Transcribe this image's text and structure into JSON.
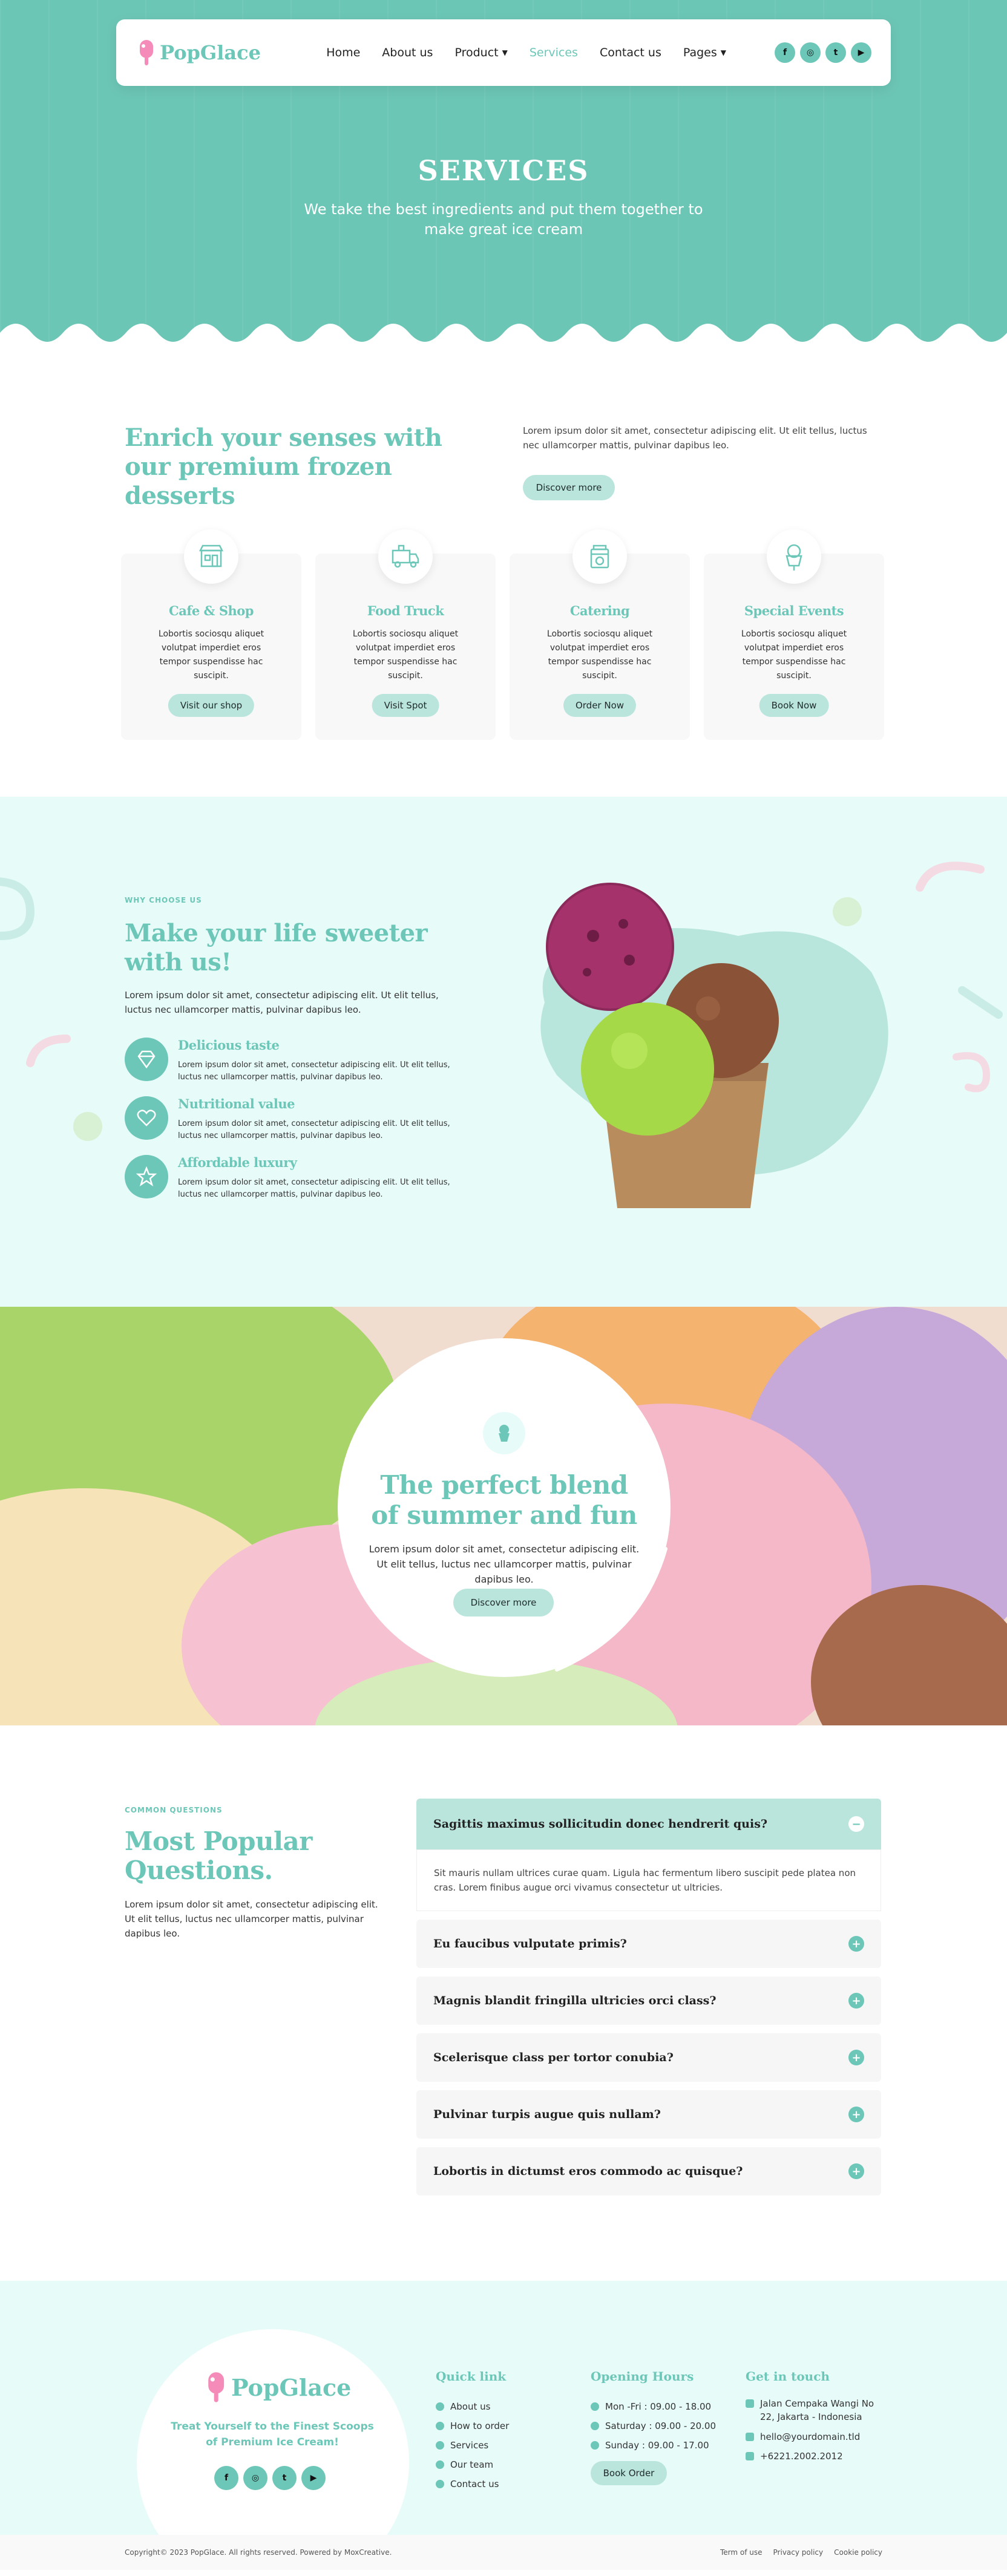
{
  "brand": {
    "name": "PopGlace",
    "primary": "#6cc7b8",
    "light": "#e7fbf8",
    "button": "#b9e5dc"
  },
  "nav": {
    "items": [
      {
        "label": "Home",
        "dropdown": false,
        "active": false
      },
      {
        "label": "About us",
        "dropdown": false,
        "active": false
      },
      {
        "label": "Product",
        "dropdown": true,
        "active": false
      },
      {
        "label": "Services",
        "dropdown": false,
        "active": true
      },
      {
        "label": "Contact us",
        "dropdown": false,
        "active": false
      },
      {
        "label": "Pages",
        "dropdown": true,
        "active": false
      }
    ],
    "social": [
      "facebook-icon",
      "instagram-icon",
      "twitter-icon",
      "youtube-icon"
    ]
  },
  "hero": {
    "title": "SERVICES",
    "subtitle": "We take the best ingredients and put them together to make great ice cream"
  },
  "enrich": {
    "title": "Enrich your senses with our premium frozen desserts",
    "text": "Lorem ipsum dolor sit amet, consectetur adipiscing elit. Ut elit tellus, luctus nec ullamcorper mattis, pulvinar dapibus leo.",
    "button": "Discover more",
    "cards": [
      {
        "icon": "shop-icon",
        "title": "Cafe & Shop",
        "text": "Lobortis sociosqu aliquet volutpat imperdiet eros tempor suspendisse hac suscipit.",
        "button": "Visit our shop"
      },
      {
        "icon": "food-truck-icon",
        "title": "Food Truck",
        "text": "Lobortis sociosqu aliquet volutpat imperdiet eros tempor suspendisse hac suscipit.",
        "button": "Visit Spot"
      },
      {
        "icon": "catering-icon",
        "title": "Catering",
        "text": "Lobortis sociosqu aliquet volutpat imperdiet eros tempor suspendisse hac suscipit.",
        "button": "Order Now"
      },
      {
        "icon": "ice-cream-cup-icon",
        "title": "Special Events",
        "text": "Lobortis sociosqu aliquet volutpat imperdiet eros tempor suspendisse hac suscipit.",
        "button": "Book Now"
      }
    ]
  },
  "why": {
    "eyebrow": "WHY CHOOSE US",
    "title": "Make your life sweeter with us!",
    "text": "Lorem ipsum dolor sit amet, consectetur adipiscing elit. Ut elit tellus, luctus nec ullamcorper mattis, pulvinar dapibus leo.",
    "features": [
      {
        "icon": "diamond-icon",
        "title": "Delicious taste",
        "text": "Lorem ipsum dolor sit amet, consectetur adipiscing elit. Ut elit tellus, luctus nec ullamcorper mattis, pulvinar dapibus leo."
      },
      {
        "icon": "heart-icon",
        "title": "Nutritional value",
        "text": "Lorem ipsum dolor sit amet, consectetur adipiscing elit. Ut elit tellus, luctus nec ullamcorper mattis, pulvinar dapibus leo."
      },
      {
        "icon": "star-icon",
        "title": "Affordable luxury",
        "text": "Lorem ipsum dolor sit amet, consectetur adipiscing elit. Ut elit tellus, luctus nec ullamcorper mattis, pulvinar dapibus leo."
      }
    ]
  },
  "blend": {
    "title": "The perfect blend of summer and fun",
    "text": "Lorem ipsum dolor sit amet, consectetur adipiscing elit. Ut elit tellus, luctus nec ullamcorper mattis, pulvinar dapibus leo.",
    "button": "Discover more"
  },
  "faq": {
    "eyebrow": "COMMON QUESTIONS",
    "title": "Most Popular Questions.",
    "text": "Lorem ipsum dolor sit amet, consectetur adipiscing elit. Ut elit tellus, luctus nec ullamcorper mattis, pulvinar dapibus leo.",
    "open_answer": "Sit mauris nullam ultrices curae quam. Ligula hac fermentum libero suscipit pede platea non cras. Lorem finibus augue orci vivamus consectetur ut ultricies.",
    "items": [
      {
        "q": "Sagittis maximus sollicitudin donec hendrerit quis?",
        "open": true
      },
      {
        "q": "Eu faucibus vulputate primis?",
        "open": false
      },
      {
        "q": "Magnis blandit fringilla ultricies orci class?",
        "open": false
      },
      {
        "q": "Scelerisque class per tortor conubia?",
        "open": false
      },
      {
        "q": "Pulvinar turpis augue quis nullam?",
        "open": false
      },
      {
        "q": "Lobortis in dictumst eros commodo ac quisque?",
        "open": false
      }
    ]
  },
  "footer": {
    "tagline": "Treat Yourself to the Finest Scoops of Premium Ice Cream!",
    "quick_title": "Quick link",
    "quick_links": [
      "About us",
      "How to order",
      "Services",
      "Our team",
      "Contact us"
    ],
    "hours_title": "Opening Hours",
    "hours": [
      "Mon -Fri : 09.00 - 18.00",
      "Saturday : 09.00 - 20.00",
      "Sunday : 09.00 - 17.00"
    ],
    "hours_button": "Book Order",
    "contact_title": "Get in touch",
    "contact": [
      {
        "icon": "location-icon",
        "text": "Jalan Cempaka Wangi No 22, Jakarta - Indonesia"
      },
      {
        "icon": "mail-icon",
        "text": "hello@yourdomain.tld"
      },
      {
        "icon": "phone-icon",
        "text": "+6221.2002.2012"
      }
    ],
    "copyright": "Copyright© 2023 PopGlace. All rights reserved. Powered by MoxCreative.",
    "bottom_links": [
      "Term of use",
      "Privacy policy",
      "Cookie policy"
    ]
  }
}
